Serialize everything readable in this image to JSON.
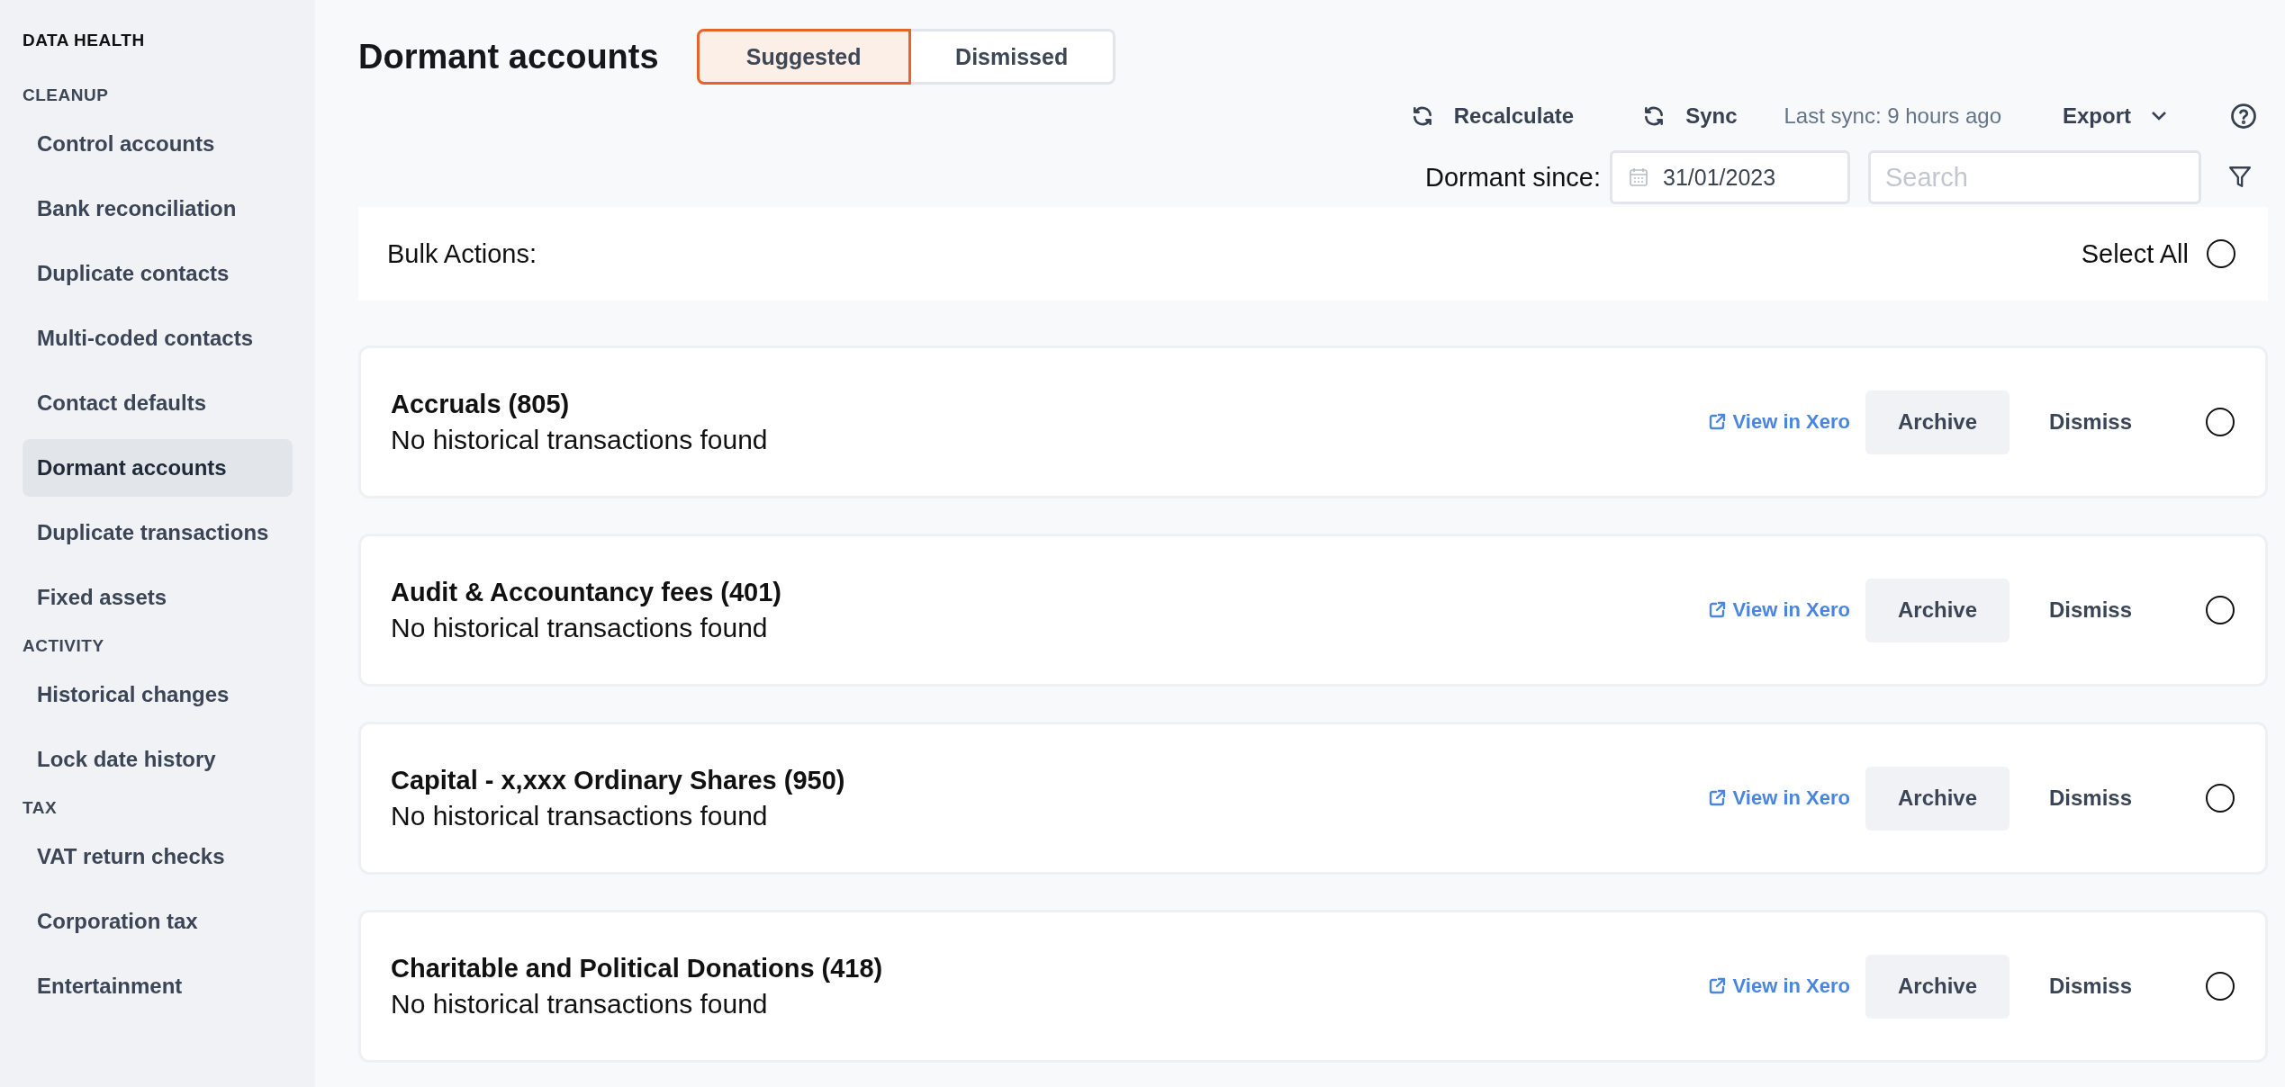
{
  "sidebar": {
    "title": "DATA HEALTH",
    "sections": [
      {
        "heading": "CLEANUP",
        "items": [
          {
            "label": "Control accounts",
            "selected": false
          },
          {
            "label": "Bank reconciliation",
            "selected": false
          },
          {
            "label": "Duplicate contacts",
            "selected": false
          },
          {
            "label": "Multi-coded contacts",
            "selected": false
          },
          {
            "label": "Contact defaults",
            "selected": false
          },
          {
            "label": "Dormant accounts",
            "selected": true
          },
          {
            "label": "Duplicate transactions",
            "selected": false
          },
          {
            "label": "Fixed assets",
            "selected": false
          }
        ]
      },
      {
        "heading": "ACTIVITY",
        "items": [
          {
            "label": "Historical changes",
            "selected": false
          },
          {
            "label": "Lock date history",
            "selected": false
          }
        ]
      },
      {
        "heading": "TAX",
        "items": [
          {
            "label": "VAT return checks",
            "selected": false
          },
          {
            "label": "Corporation tax",
            "selected": false
          },
          {
            "label": "Entertainment",
            "selected": false
          }
        ]
      }
    ]
  },
  "page": {
    "title": "Dormant accounts",
    "tabs": [
      {
        "label": "Suggested",
        "selected": true
      },
      {
        "label": "Dismissed",
        "selected": false
      }
    ]
  },
  "toolbar": {
    "recalculate": "Recalculate",
    "sync": "Sync",
    "last_sync": "Last sync: 9 hours ago",
    "export": "Export"
  },
  "filters": {
    "dormant_label": "Dormant since:",
    "date": "31/01/2023",
    "search_placeholder": "Search"
  },
  "bulk": {
    "label": "Bulk Actions:",
    "select_all": "Select All",
    "checked": false
  },
  "accounts": [
    {
      "name": "Accruals (805)",
      "note": "No historical transactions found",
      "link": "View in Xero",
      "archive": "Archive",
      "dismiss": "Dismiss",
      "selected": false
    },
    {
      "name": "Audit & Accountancy fees (401)",
      "note": "No historical transactions found",
      "link": "View in Xero",
      "archive": "Archive",
      "dismiss": "Dismiss",
      "selected": false
    },
    {
      "name": "Capital - x,xxx Ordinary Shares (950)",
      "note": "No historical transactions found",
      "link": "View in Xero",
      "archive": "Archive",
      "dismiss": "Dismiss",
      "selected": false
    },
    {
      "name": "Charitable and Political Donations (418)",
      "note": "No historical transactions found",
      "link": "View in Xero",
      "archive": "Archive",
      "dismiss": "Dismiss",
      "selected": false
    }
  ]
}
